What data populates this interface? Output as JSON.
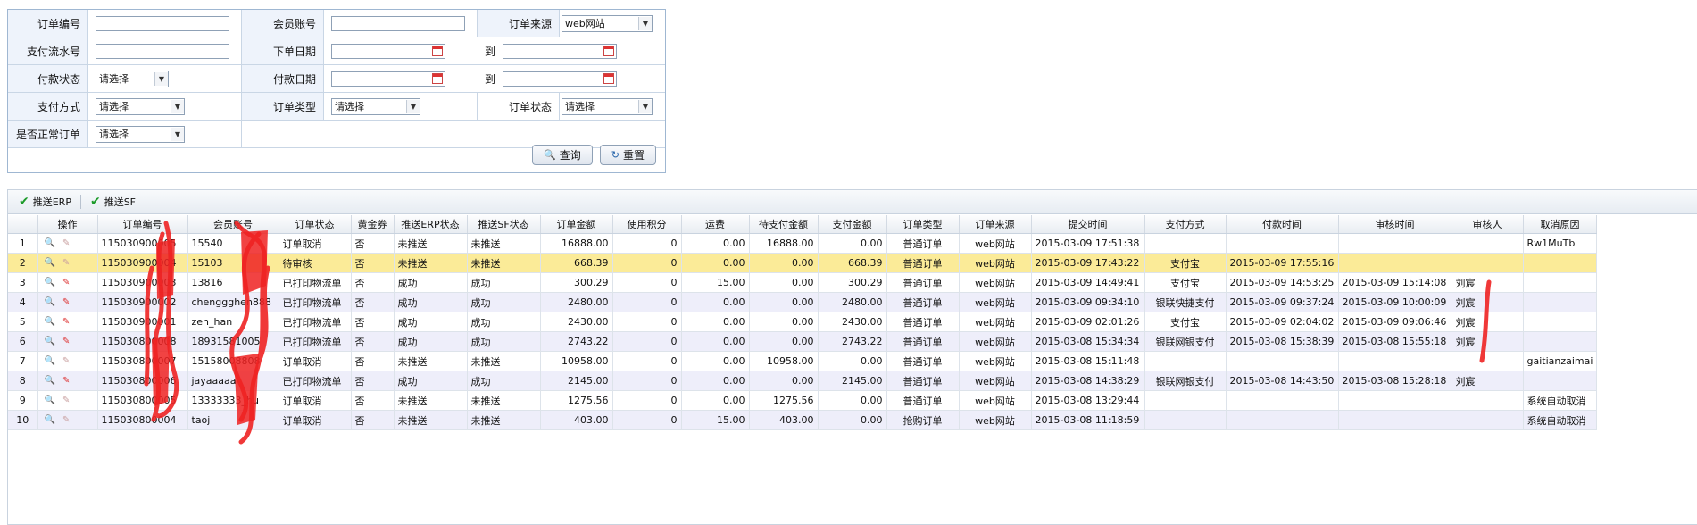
{
  "search": {
    "labels": {
      "order_no": "订单编号",
      "member": "会员账号",
      "source": "订单来源",
      "pay_serial": "支付流水号",
      "order_date": "下单日期",
      "to": "到",
      "pay_status": "付款状态",
      "pay_date": "付款日期",
      "pay_method": "支付方式",
      "order_type": "订单类型",
      "order_status": "订单状态",
      "normal_order": "是否正常订单"
    },
    "values": {
      "source": "web网站",
      "pay_status": "请选择",
      "pay_method": "请选择",
      "order_type": "请选择",
      "order_status": "请选择",
      "normal_order": "请选择"
    },
    "buttons": {
      "query": "查询",
      "reset": "重置"
    }
  },
  "toolbar": {
    "push_erp": "推送ERP",
    "push_sf": "推送SF"
  },
  "table": {
    "headers": [
      "",
      "操作",
      "订单编号",
      "会员账号",
      "订单状态",
      "黄金券",
      "推送ERP状态",
      "推送SF状态",
      "订单金额",
      "使用积分",
      "运费",
      "待支付金额",
      "支付金额",
      "订单类型",
      "订单来源",
      "提交时间",
      "支付方式",
      "付款时间",
      "审核时间",
      "审核人",
      "取消原因"
    ],
    "rows": [
      [
        "1",
        "115030900005",
        "15540",
        "订单取消",
        "否",
        "未推送",
        "未推送",
        "16888.00",
        "0",
        "0.00",
        "16888.00",
        "0.00",
        "普通订单",
        "web网站",
        "2015-03-09 17:51:38",
        "",
        "",
        "",
        "",
        "Rw1MuTb"
      ],
      [
        "2",
        "115030900004",
        "15103",
        "待审核",
        "否",
        "未推送",
        "未推送",
        "668.39",
        "0",
        "0.00",
        "0.00",
        "668.39",
        "普通订单",
        "web网站",
        "2015-03-09 17:43:22",
        "支付宝",
        "2015-03-09 17:55:16",
        "",
        "",
        ""
      ],
      [
        "3",
        "115030900003",
        "13816",
        "已打印物流单",
        "否",
        "成功",
        "成功",
        "300.29",
        "0",
        "15.00",
        "0.00",
        "300.29",
        "普通订单",
        "web网站",
        "2015-03-09 14:49:41",
        "支付宝",
        "2015-03-09 14:53:25",
        "2015-03-09 15:14:08",
        "刘宸",
        ""
      ],
      [
        "4",
        "115030900002",
        "chenggghen888",
        "已打印物流单",
        "否",
        "成功",
        "成功",
        "2480.00",
        "0",
        "0.00",
        "0.00",
        "2480.00",
        "普通订单",
        "web网站",
        "2015-03-09 09:34:10",
        "银联快捷支付",
        "2015-03-09 09:37:24",
        "2015-03-09 10:00:09",
        "刘宸",
        ""
      ],
      [
        "5",
        "115030900001",
        "zen_han",
        "已打印物流单",
        "否",
        "成功",
        "成功",
        "2430.00",
        "0",
        "0.00",
        "0.00",
        "2430.00",
        "普通订单",
        "web网站",
        "2015-03-09 02:01:26",
        "支付宝",
        "2015-03-09 02:04:02",
        "2015-03-09 09:06:46",
        "刘宸",
        ""
      ],
      [
        "6",
        "115030800008",
        "18931581005",
        "已打印物流单",
        "否",
        "成功",
        "成功",
        "2743.22",
        "0",
        "0.00",
        "0.00",
        "2743.22",
        "普通订单",
        "web网站",
        "2015-03-08 15:34:34",
        "银联网银支付",
        "2015-03-08 15:38:39",
        "2015-03-08 15:55:18",
        "刘宸",
        ""
      ],
      [
        "7",
        "115030800007",
        "15158008808",
        "订单取消",
        "否",
        "未推送",
        "未推送",
        "10958.00",
        "0",
        "0.00",
        "10958.00",
        "0.00",
        "普通订单",
        "web网站",
        "2015-03-08 15:11:48",
        "",
        "",
        "",
        "",
        "gaitianzaimai"
      ],
      [
        "8",
        "115030800006",
        "jayaaaaa",
        "已打印物流单",
        "否",
        "成功",
        "成功",
        "2145.00",
        "0",
        "0.00",
        "0.00",
        "2145.00",
        "普通订单",
        "web网站",
        "2015-03-08 14:38:29",
        "银联网银支付",
        "2015-03-08 14:43:50",
        "2015-03-08 15:28:18",
        "刘宸",
        ""
      ],
      [
        "9",
        "115030800005",
        "13333333_hu",
        "订单取消",
        "否",
        "未推送",
        "未推送",
        "1275.56",
        "0",
        "0.00",
        "1275.56",
        "0.00",
        "普通订单",
        "web网站",
        "2015-03-08 13:29:44",
        "",
        "",
        "",
        "",
        "系统自动取消"
      ],
      [
        "10",
        "115030800004",
        "taoj",
        "订单取消",
        "否",
        "未推送",
        "未推送",
        "403.00",
        "0",
        "15.00",
        "403.00",
        "0.00",
        "抢购订单",
        "web网站",
        "2015-03-08 11:18:59",
        "",
        "",
        "",
        "",
        "系统自动取消"
      ]
    ]
  },
  "colors": {
    "accent_border": "#9fb7d2",
    "selected_row": "#fbeb98",
    "alt_row": "#eeeefa",
    "scribble": "#ee2222"
  },
  "icons": [
    "search-icon",
    "refresh-icon",
    "check-icon",
    "magnifier-icon",
    "edit-icon",
    "calendar-icon",
    "chevron-down-icon"
  ]
}
